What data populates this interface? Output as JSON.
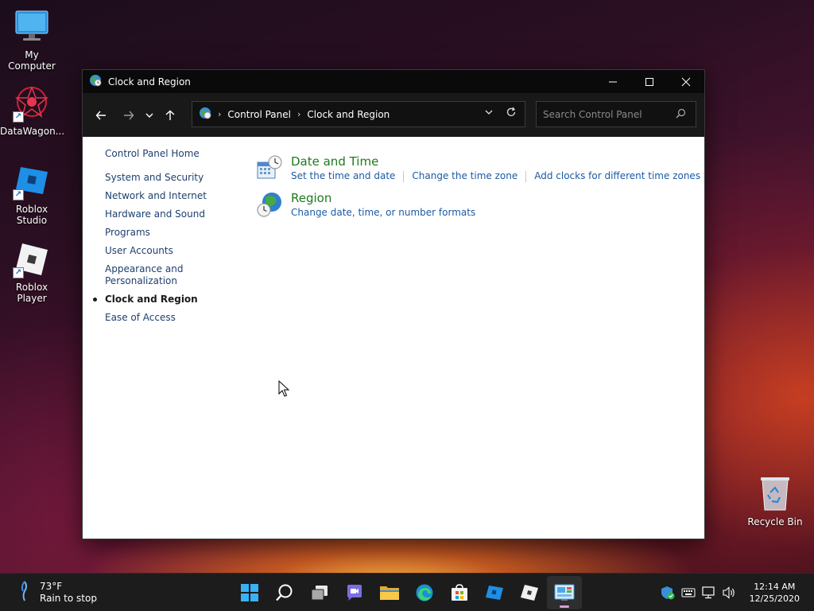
{
  "desktop": {
    "icons": [
      {
        "label": "My Computer"
      },
      {
        "label": "DataWagon..."
      },
      {
        "label": "Roblox Studio"
      },
      {
        "label": "Roblox Player"
      },
      {
        "label": "Recycle Bin"
      }
    ]
  },
  "window": {
    "title": "Clock and Region",
    "address": {
      "crumbs": [
        "Control Panel",
        "Clock and Region"
      ]
    },
    "search": {
      "placeholder": "Search Control Panel"
    },
    "left_nav": {
      "home": "Control Panel Home",
      "items": [
        {
          "label": "System and Security"
        },
        {
          "label": "Network and Internet"
        },
        {
          "label": "Hardware and Sound"
        },
        {
          "label": "Programs"
        },
        {
          "label": "User Accounts"
        },
        {
          "label": "Appearance and Personalization"
        },
        {
          "label": "Clock and Region",
          "active": true
        },
        {
          "label": "Ease of Access"
        }
      ]
    },
    "categories": [
      {
        "title": "Date and Time",
        "icon": "calendar-clock-icon",
        "links": [
          "Set the time and date",
          "Change the time zone",
          "Add clocks for different time zones"
        ]
      },
      {
        "title": "Region",
        "icon": "globe-clock-icon",
        "links": [
          "Change date, time, or number formats"
        ]
      }
    ]
  },
  "taskbar": {
    "weather": {
      "temp": "73°F",
      "desc": "Rain to stop"
    },
    "clock": {
      "time": "12:14 AM",
      "date": "12/25/2020"
    },
    "apps": [
      "start-icon",
      "search-icon",
      "task-view-icon",
      "chat-icon",
      "file-explorer-icon",
      "edge-icon",
      "store-icon",
      "roblox-studio-icon",
      "roblox-player-icon",
      "control-panel-icon"
    ],
    "tray": [
      "security-icon",
      "keyboard-icon",
      "network-icon",
      "volume-icon"
    ]
  },
  "colors": {
    "category_title": "#1e7a1e",
    "link": "#1c5aa6",
    "nav_link": "#1e3f6e"
  }
}
